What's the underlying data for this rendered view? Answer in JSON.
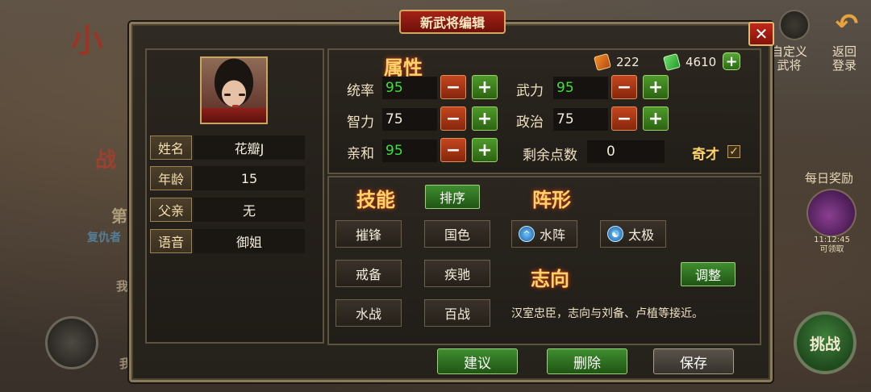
{
  "background": {
    "game_title_fragment": "小",
    "left_labels": [
      "战",
      "第",
      "复仇者",
      "我",
      "我"
    ],
    "right_menu": [
      {
        "label": "自定义\n武将"
      },
      {
        "label": "返回\n登录"
      }
    ],
    "daily_reward": {
      "label": "每日奖励",
      "time": "11:12:45",
      "status": "可领取"
    },
    "challenge_label": "挑战"
  },
  "dialog": {
    "title": "新武将编辑",
    "close_label": "✕"
  },
  "character": {
    "fields": [
      {
        "label": "姓名",
        "value": "花瓣J"
      },
      {
        "label": "年龄",
        "value": "15"
      },
      {
        "label": "父亲",
        "value": "无"
      },
      {
        "label": "语音",
        "value": "御姐"
      }
    ]
  },
  "attributes": {
    "title": "属性",
    "resources": [
      {
        "name": "red-token",
        "value": "222"
      },
      {
        "name": "green-jade",
        "value": "4610"
      }
    ],
    "add_label": "+",
    "stats": [
      {
        "label": "统率",
        "value": "95",
        "highlight": true
      },
      {
        "label": "武力",
        "value": "95",
        "highlight": true
      },
      {
        "label": "智力",
        "value": "75",
        "highlight": false
      },
      {
        "label": "政治",
        "value": "75",
        "highlight": false
      },
      {
        "label": "亲和",
        "value": "95",
        "highlight": true
      }
    ],
    "remaining_label": "剩余点数",
    "remaining_value": "0",
    "talent_label": "奇才",
    "talent_checked": "✓",
    "minus": "−",
    "plus": "+"
  },
  "skills": {
    "title": "技能",
    "sort_label": "排序",
    "items": [
      "摧锋",
      "国色",
      "戒备",
      "疾驰",
      "水战",
      "百战"
    ]
  },
  "formation": {
    "title": "阵形",
    "items": [
      {
        "label": "水阵",
        "icon": "^"
      },
      {
        "label": "太极",
        "icon": "☯"
      }
    ]
  },
  "ambition": {
    "title": "志向",
    "adjust_label": "调整",
    "text": "汉室忠臣，志向与刘备、卢植等接近。"
  },
  "actions": {
    "suggest": "建议",
    "delete": "删除",
    "save": "保存"
  }
}
